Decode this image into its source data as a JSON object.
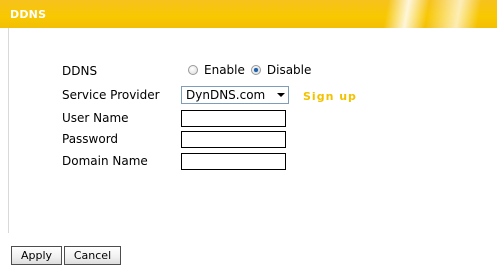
{
  "header": {
    "title": "DDNS"
  },
  "form": {
    "ddns": {
      "label": "DDNS",
      "options": [
        {
          "label": "Enable",
          "selected": false
        },
        {
          "label": "Disable",
          "selected": true
        }
      ]
    },
    "service_provider": {
      "label": "Service Provider",
      "value": "DynDNS.com",
      "signup_label": "Sign up"
    },
    "user_name": {
      "label": "User Name",
      "value": ""
    },
    "password": {
      "label": "Password",
      "value": ""
    },
    "domain_name": {
      "label": "Domain Name",
      "value": ""
    }
  },
  "footer": {
    "apply_label": "Apply",
    "cancel_label": "Cancel"
  },
  "colors": {
    "header_bg": "#f8c800",
    "signup_color": "#f2c200"
  },
  "icons": {
    "dropdown": "chevron-down-icon"
  }
}
